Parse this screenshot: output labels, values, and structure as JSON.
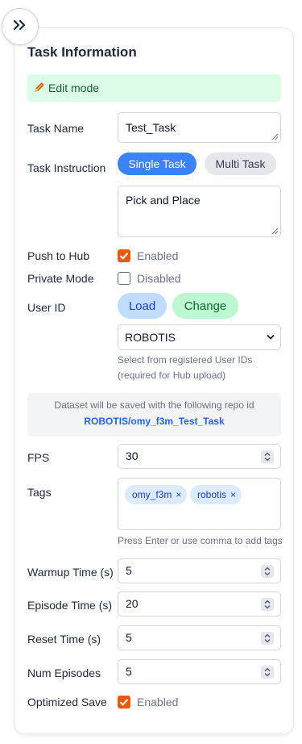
{
  "panel": {
    "title": "Task Information",
    "edit_mode": "Edit mode"
  },
  "icons": {
    "collapse": "chevrons-right-icon",
    "edit": "pencil-icon"
  },
  "task_name": {
    "label": "Task Name",
    "value": "Test_Task"
  },
  "task_instruction": {
    "label": "Task Instruction",
    "modes": [
      "Single Task",
      "Multi Task"
    ],
    "selected_mode": "Single Task",
    "value": "Pick and Place"
  },
  "push_to_hub": {
    "label": "Push to Hub",
    "checked": true,
    "state_text": "Enabled"
  },
  "private_mode": {
    "label": "Private Mode",
    "checked": false,
    "state_text": "Disabled"
  },
  "user_id": {
    "label": "User ID",
    "load_label": "Load",
    "change_label": "Change",
    "selected": "ROBOTIS",
    "hint_line1": "Select from registered User IDs",
    "hint_line2": "(required for Hub upload)"
  },
  "repo_notice": {
    "text": "Dataset will be saved with the following repo id",
    "repo_id": "ROBOTIS/omy_f3m_Test_Task"
  },
  "fps": {
    "label": "FPS",
    "value": "30"
  },
  "tags": {
    "label": "Tags",
    "items": [
      "omy_f3m",
      "robotis"
    ],
    "hint": "Press Enter or use comma to add tags"
  },
  "warmup_time": {
    "label": "Warmup Time (s)",
    "value": "5"
  },
  "episode_time": {
    "label": "Episode Time (s)",
    "value": "20"
  },
  "reset_time": {
    "label": "Reset Time (s)",
    "value": "5"
  },
  "num_episodes": {
    "label": "Num Episodes",
    "value": "5"
  },
  "optimized_save": {
    "label": "Optimized Save",
    "checked": true,
    "state_text": "Enabled"
  },
  "colors": {
    "accent": "#3b82f6",
    "success_bg": "#dcfce7",
    "checkbox": "#ea580c",
    "tag_bg": "#dbeafe"
  }
}
